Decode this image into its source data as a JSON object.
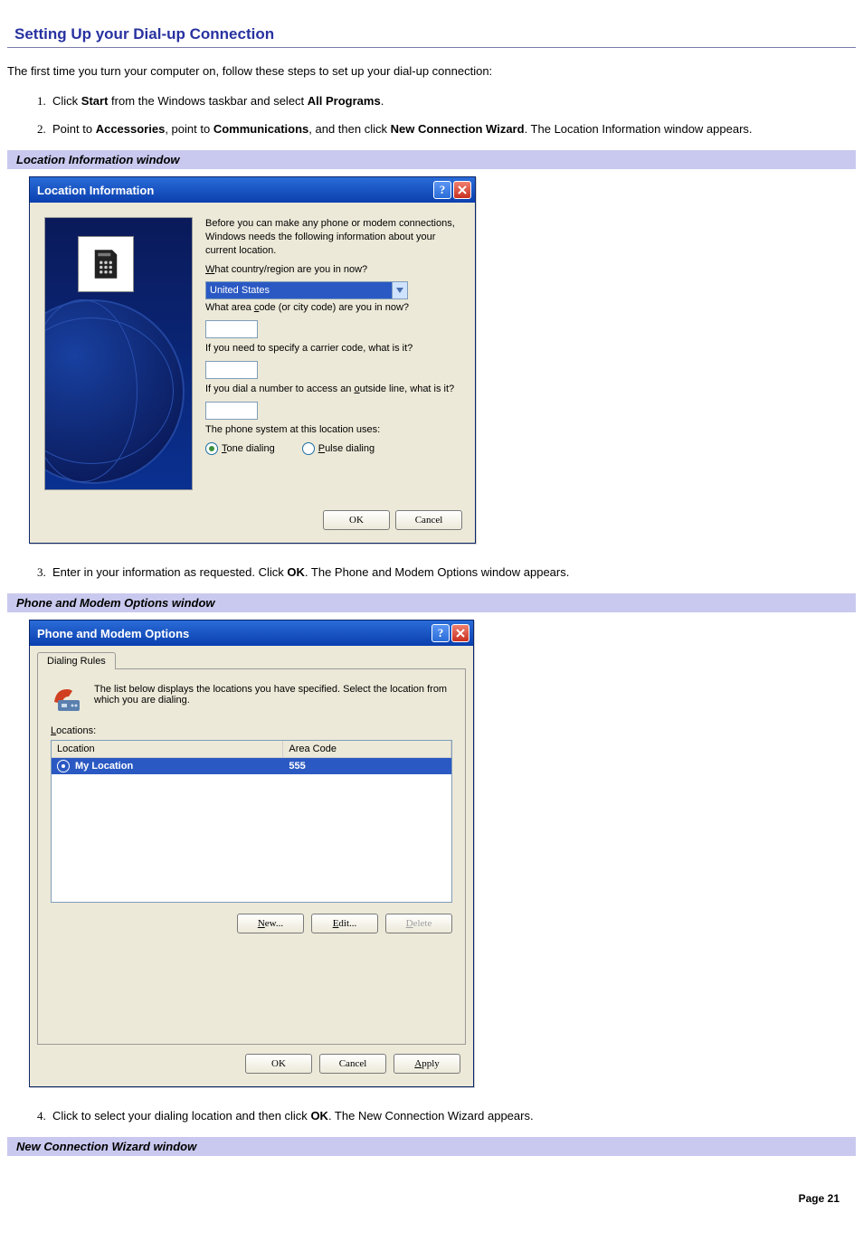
{
  "page": {
    "heading": "Setting Up your Dial-up Connection",
    "intro": "The first time you turn your computer on, follow these steps to set up your dial-up connection:",
    "footer": "Page 21"
  },
  "steps": {
    "s1": {
      "pre": "Click ",
      "b1": "Start",
      "mid": " from the Windows taskbar and select ",
      "b2": "All Programs",
      "post": "."
    },
    "s2": {
      "pre": "Point to ",
      "b1": "Accessories",
      "mid1": ", point to ",
      "b2": "Communications",
      "mid2": ", and then click ",
      "b3": "New Connection Wizard",
      "post": ". The Location Information window appears."
    },
    "s3": {
      "pre": "Enter in your information as requested. Click ",
      "b1": "OK",
      "post": ". The Phone and Modem Options window appears."
    },
    "s4": {
      "pre": "Click to select your dialing location and then click ",
      "b1": "OK",
      "post": ". The New Connection Wizard appears."
    }
  },
  "captions": {
    "location": "Location Information window",
    "phone_modem": "Phone and Modem Options window",
    "new_conn": "New Connection Wizard window"
  },
  "location_dialog": {
    "title": "Location Information",
    "intro": "Before you can make any phone or modem connections, Windows needs the following information about your current location.",
    "q_country_pre": "W",
    "q_country_post": "hat country/region are you in now?",
    "country_value": "United States",
    "q_area_pre": "What area ",
    "q_area_u": "c",
    "q_area_post": "ode (or city code) are you in now?",
    "q_carrier": "If you need to specify a carrier code, what is it?",
    "q_outside_pre": "If you dial a number to access an ",
    "q_outside_u": "o",
    "q_outside_post": "utside line, what is it?",
    "phone_system": "The phone system at this location uses:",
    "tone_u": "T",
    "tone_rest": "one dialing",
    "pulse_u": "P",
    "pulse_rest": "ulse dialing",
    "ok": "OK",
    "cancel": "Cancel"
  },
  "pm_dialog": {
    "title": "Phone and Modem Options",
    "tab": "Dialing Rules",
    "desc": "The list below displays the locations you have specified. Select the location from which you are dialing.",
    "locations_u": "L",
    "locations_rest": "ocations:",
    "th_location": "Location",
    "th_area": "Area Code",
    "row_location": "My Location",
    "row_area": "555",
    "new_u": "N",
    "new_rest": "ew...",
    "edit_u": "E",
    "edit_rest": "dit...",
    "delete_u": "D",
    "delete_rest": "elete",
    "ok": "OK",
    "cancel": "Cancel",
    "apply_u": "A",
    "apply_rest": "pply"
  }
}
